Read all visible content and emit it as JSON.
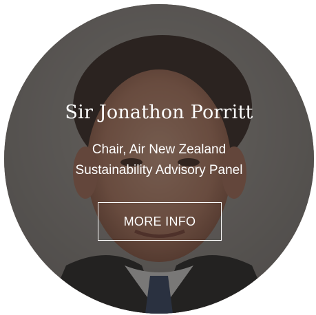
{
  "profile": {
    "name": "Sir Jonathon Porritt",
    "role_line_1": "Chair, Air New Zealand",
    "role_line_2": "Sustainability Advisory Panel",
    "button_label": "MORE INFO"
  },
  "colors": {
    "overlay": "#1e1e1e",
    "text": "#ffffff",
    "page_background": "#ffffff"
  }
}
